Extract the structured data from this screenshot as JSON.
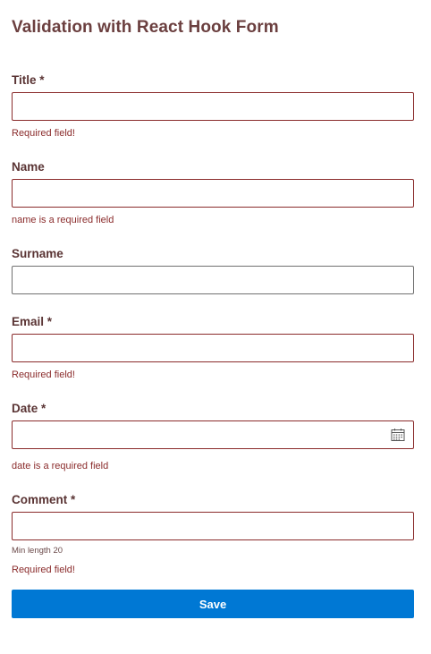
{
  "form": {
    "title": "Validation with React Hook Form",
    "fields": [
      {
        "label": "Title *",
        "error": "Required field!"
      },
      {
        "label": "Name",
        "error": "name is a required field"
      },
      {
        "label": "Surname"
      },
      {
        "label": "Email *",
        "error": "Required field!"
      },
      {
        "label": "Date *",
        "error": "date is a required field",
        "icon": "calendar-icon"
      },
      {
        "label": "Comment *",
        "hint": "Min length 20",
        "error": "Required field!"
      }
    ],
    "save_label": "Save"
  },
  "colors": {
    "error": "#8a2b2b",
    "primary": "#0078d4"
  }
}
